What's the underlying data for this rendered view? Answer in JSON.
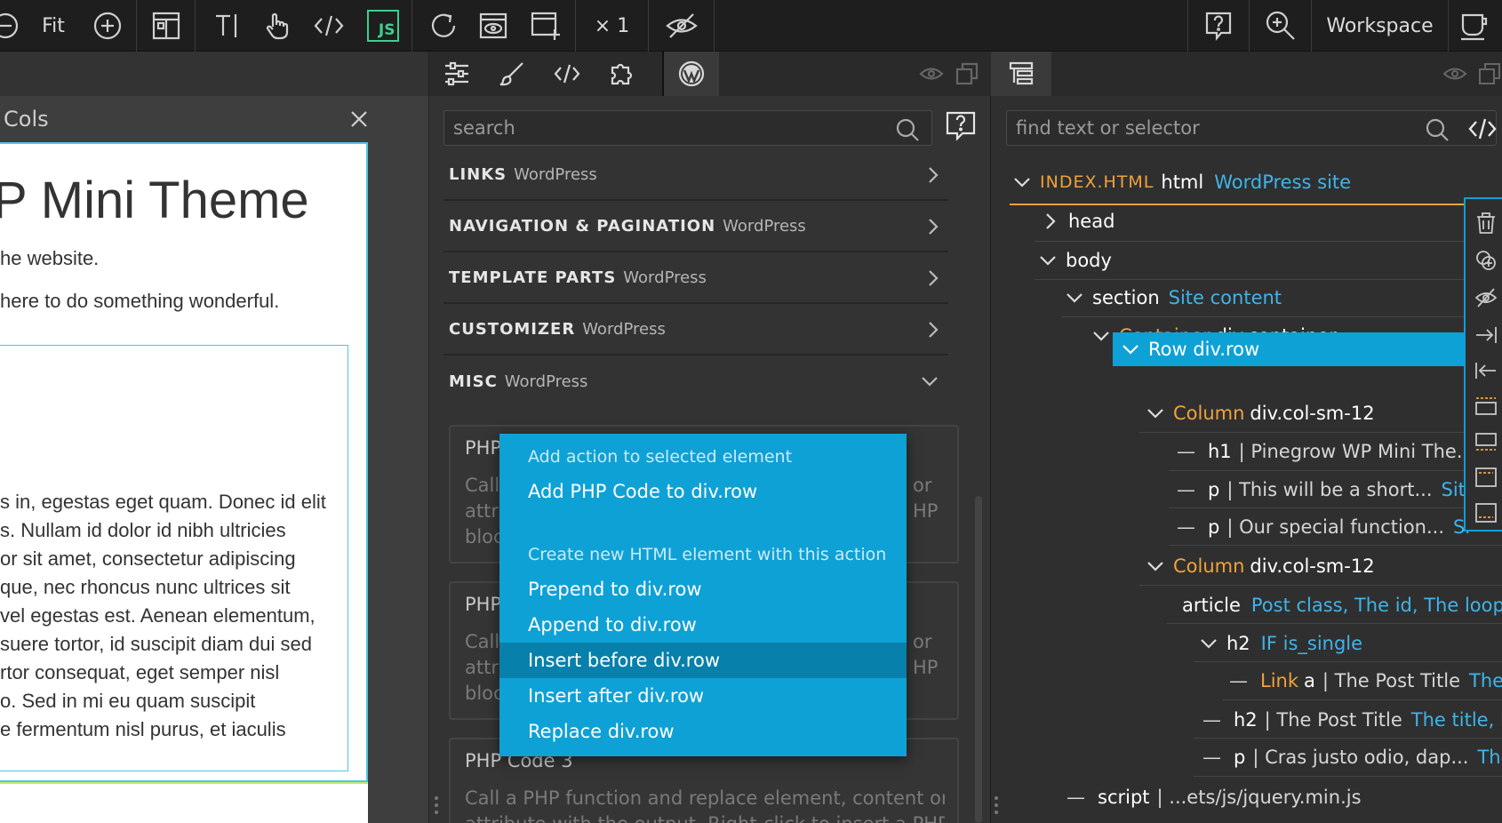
{
  "toolbar": {
    "fit_label": "Fit",
    "zoom_label": "× 1",
    "workspace_label": "Workspace",
    "js_label": "JS"
  },
  "canvas": {
    "frame_title": "Cols",
    "page_title": "P Mini Theme",
    "p1": "he website.",
    "p2": "here to do something wonderful.",
    "body_lines": [
      "s in, egestas eget quam. Donec id elit",
      "s. Nullam id dolor id nibh ultricies",
      "or sit amet, consectetur adipiscing",
      "que, nec rhoncus nunc ultrices sit",
      "vel egestas est. Aenean elementum,",
      "suere tortor, id suscipit diam dui sed",
      "rtor consequat, eget semper nisl",
      "o. Sed in mi eu quam suscipit",
      "e fermentum nisl purus, et iaculis"
    ]
  },
  "library": {
    "search_placeholder": "search",
    "sections": [
      {
        "name": "LINKS",
        "sub": "WordPress"
      },
      {
        "name": "NAVIGATION & PAGINATION",
        "sub": "WordPress"
      },
      {
        "name": "TEMPLATE PARTS",
        "sub": "WordPress"
      },
      {
        "name": "CUSTOMIZER",
        "sub": "WordPress"
      },
      {
        "name": "MISC",
        "sub": "WordPress"
      }
    ],
    "cards": [
      {
        "title": "PHP",
        "l1": "Call",
        "l2": "attri",
        "l3": "bloc",
        "r1": "or",
        "r2": "HP"
      },
      {
        "title": "PHP",
        "l1": "Call",
        "l2": "attri",
        "l3": "bloc",
        "r1": "or",
        "r2": "HP"
      },
      {
        "title": "PHP Code 3",
        "l1": "Call a PHP function and replace element, content or",
        "l2": "attribute with the output. Right-click to insert a PHP",
        "l3": "",
        "r1": "",
        "r2": ""
      }
    ]
  },
  "context_menu": {
    "header1": "Add action to selected element",
    "add_php": "Add PHP Code to div.row",
    "header2": "Create new HTML element with this action",
    "prepend": "Prepend to div.row",
    "append": "Append to div.row",
    "insert_before": "Insert before div.row",
    "insert_after": "Insert after div.row",
    "replace": "Replace div.row"
  },
  "tree": {
    "search_placeholder": "find text or selector",
    "root_file": "INDEX.HTML",
    "root_tag": "html",
    "root_label": "WordPress site",
    "head": "head",
    "body": "body",
    "section_tag": "section",
    "section_label": "Site content",
    "container_name": "Container",
    "container_tag": "div.container",
    "row_label": "Row div.row",
    "col1_name": "Column",
    "col1_tag": "div.col-sm-12",
    "h1_tag": "h1",
    "h1_text": "| Pinegrow WP Mini The...",
    "p1_tag": "p",
    "p1_text": "| This will be a short...",
    "p1_label": "Site",
    "p2_tag": "p",
    "p2_text": "| Our special function...",
    "p2_label": "Site",
    "col2_name": "Column",
    "col2_tag": "div.col-sm-12",
    "article_tag": "article",
    "article_label": "Post class, The id, The loop",
    "h2a_tag": "h2",
    "h2a_label": "IF is_single",
    "link_name": "Link",
    "link_tag": "a",
    "link_text": "| The Post Title",
    "link_label": "The t",
    "h2b_tag": "h2",
    "h2b_text": "| The Post Title",
    "h2b_label": "The title, Els",
    "p3_tag": "p",
    "p3_text": "| Cras justo odio, dap...",
    "p3_label": "The",
    "script_tag": "script",
    "script_text": "| ...ets/js/jquery.min.js"
  },
  "colors": {
    "accent": "#0ea1d6",
    "orange": "#f0a23c",
    "link_blue": "#3fb4ea"
  }
}
